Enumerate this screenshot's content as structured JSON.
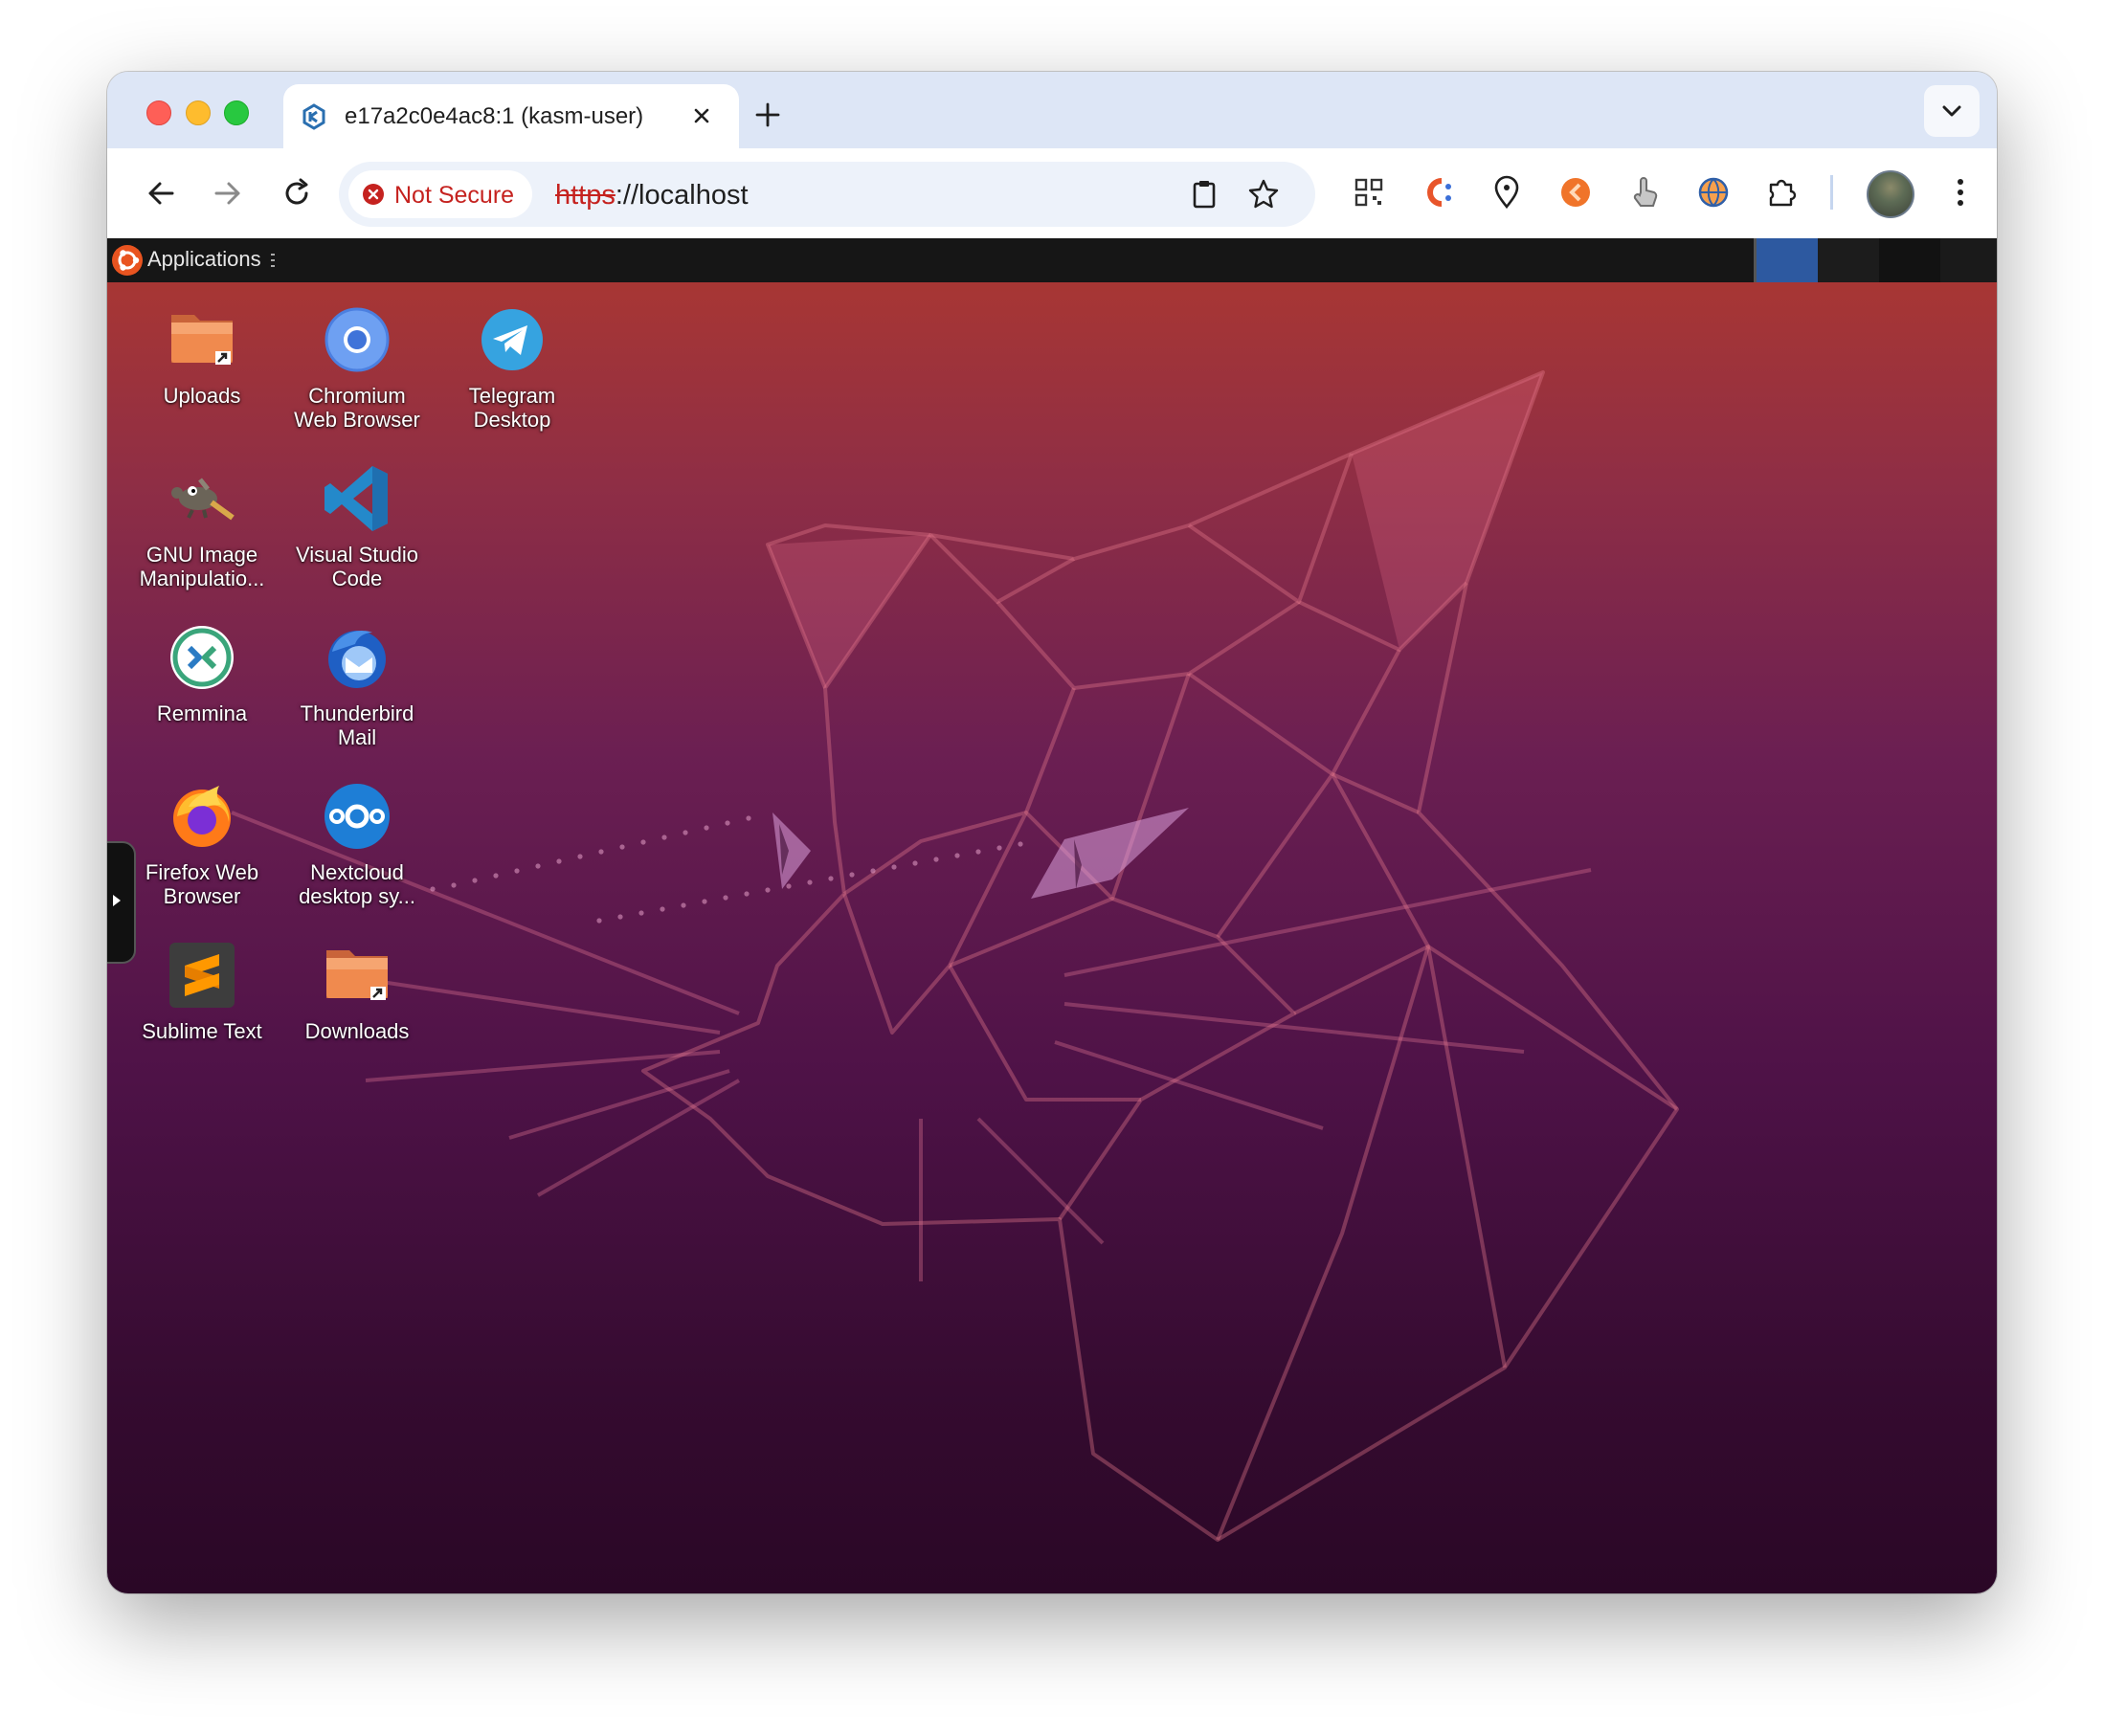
{
  "browser": {
    "tab": {
      "title": "e17a2c0e4ac8:1 (kasm-user)",
      "favicon": "kasm-logo-icon"
    },
    "address_bar": {
      "security_label": "Not Secure",
      "url_scheme": "https",
      "url_rest": "://localhost"
    },
    "extensions": [
      "qr-code-icon",
      "c-extension-icon",
      "location-pin-icon",
      "orange-extension-icon",
      "hand-pointer-icon",
      "globe-icon",
      "puzzle-icon"
    ],
    "colors": {
      "accent": "#dde6f6",
      "security_red": "#c5221f"
    }
  },
  "desktop": {
    "panel": {
      "applications_label": "Applications"
    },
    "icons": [
      {
        "label": "Uploads",
        "icon": "folder-icon"
      },
      {
        "label": "Chromium\nWeb Browser",
        "icon": "chromium-icon"
      },
      {
        "label": "Telegram\nDesktop",
        "icon": "telegram-icon"
      },
      {
        "label": "GNU Image\nManipulatio...",
        "icon": "gimp-icon"
      },
      {
        "label": "Visual Studio\nCode",
        "icon": "vscode-icon"
      },
      {
        "label": "Remmina",
        "icon": "remmina-icon"
      },
      {
        "label": "Thunderbird\nMail",
        "icon": "thunderbird-icon"
      },
      {
        "label": "Firefox Web\nBrowser",
        "icon": "firefox-icon"
      },
      {
        "label": "Nextcloud\ndesktop sy...",
        "icon": "nextcloud-icon"
      },
      {
        "label": "Sublime Text",
        "icon": "sublime-text-icon"
      },
      {
        "label": "Downloads",
        "icon": "folder-icon"
      }
    ],
    "colors": {
      "wallpaper_top": "#ad3830",
      "wallpaper_bottom": "#2a0726",
      "panel": "#161616"
    }
  }
}
